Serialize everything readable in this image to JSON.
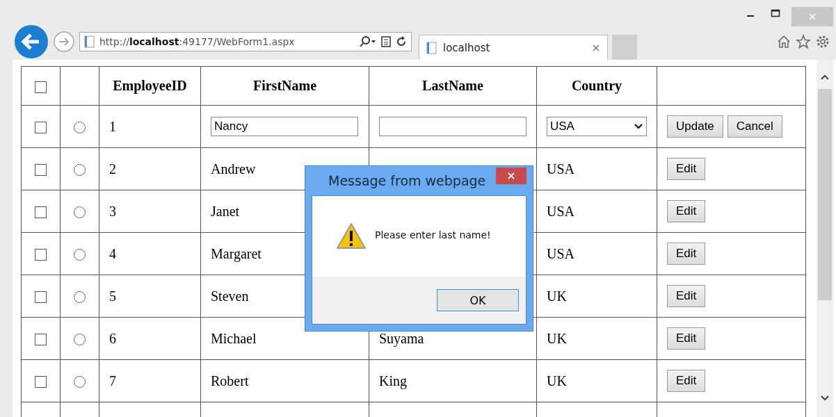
{
  "browser": {
    "address": "http://**localhost**:49177/WebForm1.aspx",
    "tabs": [
      {
        "label": "localhost",
        "selected": true
      }
    ]
  },
  "table": {
    "select_all_checked": false,
    "columns": [
      "",
      "",
      "EmployeeID",
      "FirstName",
      "LastName",
      "Country",
      ""
    ],
    "rows": [
      {
        "kind": "edit",
        "checked": false,
        "selected": false,
        "id": "1",
        "first": "Nancy",
        "last": "",
        "country": "USA",
        "buttons": [
          "Update",
          "Cancel"
        ]
      },
      {
        "kind": "view",
        "checked": false,
        "selected": false,
        "id": "2",
        "first": "Andrew",
        "last": "",
        "country": "USA",
        "buttons": [
          "Edit"
        ]
      },
      {
        "kind": "view",
        "checked": false,
        "selected": false,
        "id": "3",
        "first": "Janet",
        "last": "",
        "country": "USA",
        "buttons": [
          "Edit"
        ]
      },
      {
        "kind": "view",
        "checked": false,
        "selected": false,
        "id": "4",
        "first": "Margaret",
        "last": "",
        "country": "USA",
        "buttons": [
          "Edit"
        ]
      },
      {
        "kind": "view",
        "checked": false,
        "selected": false,
        "id": "5",
        "first": "Steven",
        "last": "",
        "country": "UK",
        "buttons": [
          "Edit"
        ]
      },
      {
        "kind": "view",
        "checked": false,
        "selected": false,
        "id": "6",
        "first": "Michael",
        "last": "Suyama",
        "country": "UK",
        "buttons": [
          "Edit"
        ]
      },
      {
        "kind": "view",
        "checked": false,
        "selected": false,
        "id": "7",
        "first": "Robert",
        "last": "King",
        "country": "UK",
        "buttons": [
          "Edit"
        ]
      }
    ]
  },
  "dialog": {
    "title": "Message from webpage",
    "message": "Please enter last name!",
    "button": "OK"
  }
}
